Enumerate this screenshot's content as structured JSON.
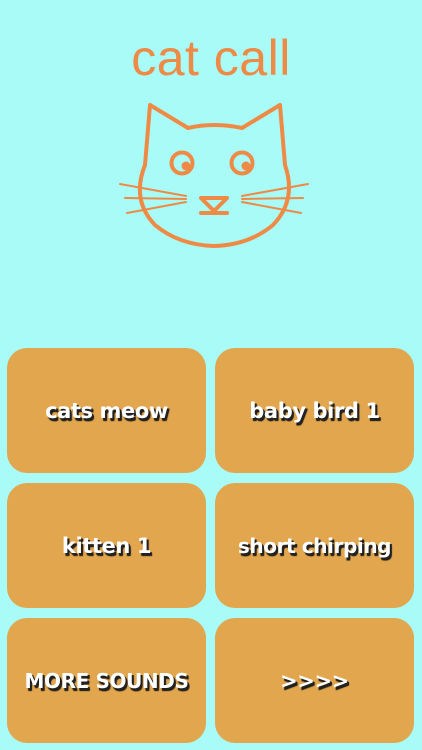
{
  "app": {
    "title": "cat call",
    "logo_icon": "cat-face-icon"
  },
  "colors": {
    "background": "#a8fbf6",
    "accent": "#ee8a45",
    "button": "#e1a64e",
    "button_text": "#ffffff"
  },
  "buttons": [
    {
      "label": "cats meow"
    },
    {
      "label": "baby bird 1"
    },
    {
      "label": "kitten 1"
    },
    {
      "label": "short chirping"
    },
    {
      "label": "MORE SOUNDS"
    },
    {
      "label": ">>>>"
    }
  ]
}
